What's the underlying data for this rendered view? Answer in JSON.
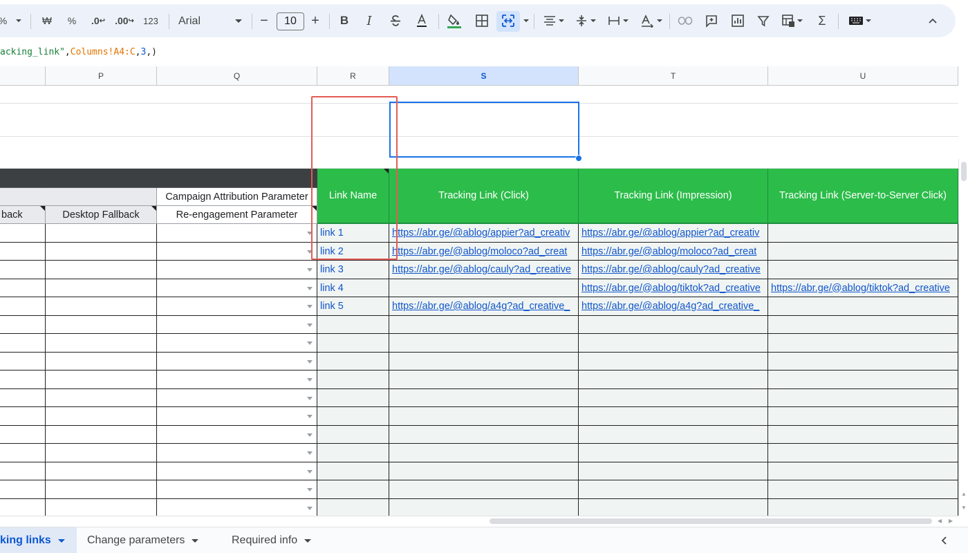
{
  "toolbar": {
    "percent": "%",
    "decrease_decimal": ".0",
    "increase_decimal": ".00",
    "number_format": "123",
    "font_family": "Arial",
    "font_size": "10",
    "bold": "B",
    "italic": "I",
    "sum": "Σ"
  },
  "formula": {
    "part1": "acking_link\"",
    "comma1": ",",
    "range": "Columns!A4:C",
    "comma2": ",",
    "num": "3",
    "end": ",)"
  },
  "columns": [
    "P",
    "Q",
    "R",
    "S",
    "T",
    "U"
  ],
  "selected_column": "S",
  "headers": {
    "campaign_attribution": "Campaign Attribution Parameter",
    "o_sub": "back",
    "p_sub": "Desktop Fallback",
    "q_sub": "Re-engagement Parameter",
    "link_name": "Link Name",
    "tracking_click": "Tracking Link (Click)",
    "tracking_impression": "Tracking Link (Impression)",
    "tracking_s2s": "Tracking Link (Server-to-Server Click)"
  },
  "rows": [
    {
      "name": "link 1",
      "click": "https://abr.ge/@ablog/appier?ad_creativ",
      "impression": "https://abr.ge/@ablog/appier?ad_creativ",
      "s2s": ""
    },
    {
      "name": "link 2",
      "click": "https://abr.ge/@ablog/moloco?ad_creat",
      "impression": "https://abr.ge/@ablog/moloco?ad_creat",
      "s2s": ""
    },
    {
      "name": "link 3",
      "click": "https://abr.ge/@ablog/cauly?ad_creative",
      "impression": "https://abr.ge/@ablog/cauly?ad_creative",
      "s2s": ""
    },
    {
      "name": "link 4",
      "click": "",
      "impression": "https://abr.ge/@ablog/tiktok?ad_creative",
      "s2s": "https://abr.ge/@ablog/tiktok?ad_creative"
    },
    {
      "name": "link 5",
      "click": "https://abr.ge/@ablog/a4g?ad_creative_",
      "impression": "https://abr.ge/@ablog/a4g?ad_creative_",
      "s2s": ""
    }
  ],
  "tabs": [
    {
      "label": "king links",
      "active": true
    },
    {
      "label": "Change parameters",
      "active": false
    },
    {
      "label": "Required info",
      "active": false
    }
  ],
  "colors": {
    "header_green": "#2cbc4a",
    "link_blue": "#1155cc",
    "selection_blue": "#1a73e8",
    "highlight_red": "#e35b54"
  }
}
